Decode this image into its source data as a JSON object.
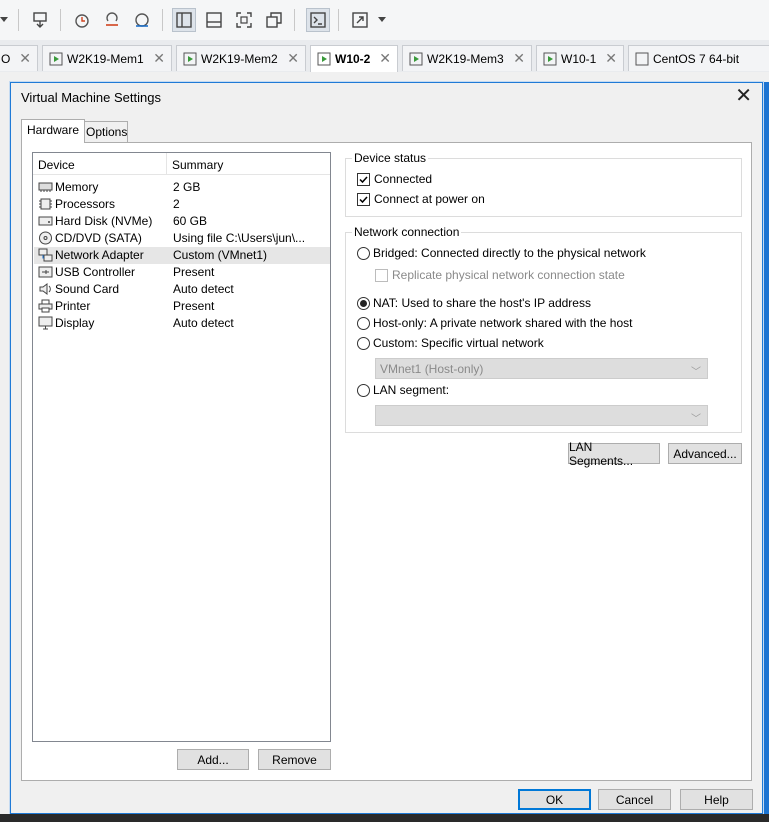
{
  "tabs": [
    {
      "label": "W2K19-Mem1"
    },
    {
      "label": "W2K19-Mem2"
    },
    {
      "label": "W10-2"
    },
    {
      "label": "W2K19-Mem3"
    },
    {
      "label": "W10-1"
    },
    {
      "label": "CentOS 7 64-bit"
    }
  ],
  "dialog": {
    "title": "Virtual Machine Settings",
    "page_tabs": [
      "Hardware",
      "Options"
    ],
    "device_list": {
      "col_device": "Device",
      "col_summary": "Summary",
      "rows": [
        {
          "name": "Memory",
          "summary": "2 GB",
          "icon": "memory-icon"
        },
        {
          "name": "Processors",
          "summary": "2",
          "icon": "processor-icon"
        },
        {
          "name": "Hard Disk (NVMe)",
          "summary": "60 GB",
          "icon": "hard-disk-icon"
        },
        {
          "name": "CD/DVD (SATA)",
          "summary": "Using file C:\\Users\\jun\\...",
          "icon": "cd-dvd-icon"
        },
        {
          "name": "Network Adapter",
          "summary": "Custom (VMnet1)",
          "icon": "network-adapter-icon"
        },
        {
          "name": "USB Controller",
          "summary": "Present",
          "icon": "usb-icon"
        },
        {
          "name": "Sound Card",
          "summary": "Auto detect",
          "icon": "sound-card-icon"
        },
        {
          "name": "Printer",
          "summary": "Present",
          "icon": "printer-icon"
        },
        {
          "name": "Display",
          "summary": "Auto detect",
          "icon": "display-icon"
        }
      ]
    },
    "add_button": "Add...",
    "remove_button": "Remove",
    "device_status": {
      "title": "Device status",
      "connected": "Connected",
      "connect_at_power_on": "Connect at power on"
    },
    "network_connection": {
      "title": "Network connection",
      "bridged": "Bridged: Connected directly to the physical network",
      "replicate": "Replicate physical network connection state",
      "nat": "NAT: Used to share the host's IP address",
      "host_only": "Host-only: A private network shared with the host",
      "custom": "Custom: Specific virtual network",
      "custom_value": "VMnet1 (Host-only)",
      "lan_segment": "LAN segment:",
      "lan_segment_value": ""
    },
    "lan_segments_button": "LAN Segments...",
    "advanced_button": "Advanced...",
    "ok_button": "OK",
    "cancel_button": "Cancel",
    "help_button": "Help"
  },
  "colors": {
    "accent": "#0078d7",
    "selected_row": "#e6e6e6"
  }
}
